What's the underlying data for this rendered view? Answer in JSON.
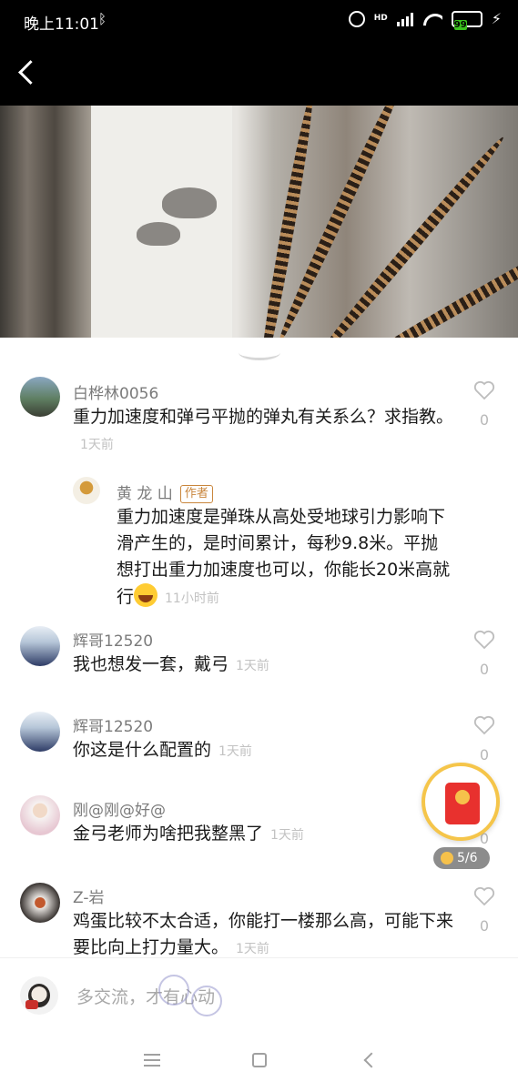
{
  "status_bar": {
    "time": "晚上11:01",
    "bluetooth_icon": "bluetooth-icon",
    "network": "HD",
    "battery": "99"
  },
  "comments": [
    {
      "user": "白桦林0056",
      "text": "重力加速度和弹弓平抛的弹丸有关系么？求指教。",
      "time": "1天前",
      "likes": "0",
      "reply": {
        "user": "黄 龙 山",
        "badge": "作者",
        "text": "重力加速度是弹珠从高处受地球引力影响下滑产生的，是时间累计，每秒9.8米。平抛想打出重力加速度也可以，你能长20米高就行",
        "time": "11小时前"
      }
    },
    {
      "user": "辉哥12520",
      "text": "我也想发一套，戴弓",
      "time": "1天前",
      "likes": "0"
    },
    {
      "user": "辉哥12520",
      "text": "你这是什么配置的",
      "time": "1天前",
      "likes": "0"
    },
    {
      "user": "刚@刚@好@",
      "text": "金弓老师为啥把我整黑了",
      "time": "1天前",
      "likes": "0"
    },
    {
      "user": "Z-岩",
      "text": "鸡蛋比较不太合适，你能打一楼那么高，可能下来要比向上打力量大。",
      "time": "1天前",
      "likes": "0"
    }
  ],
  "red_packet": {
    "progress": "5/6"
  },
  "input": {
    "placeholder": "多交流，才有心动"
  },
  "colors": {
    "accent": "#c9863d",
    "red_packet": "#e8312e",
    "ring": "#f5c54a"
  }
}
